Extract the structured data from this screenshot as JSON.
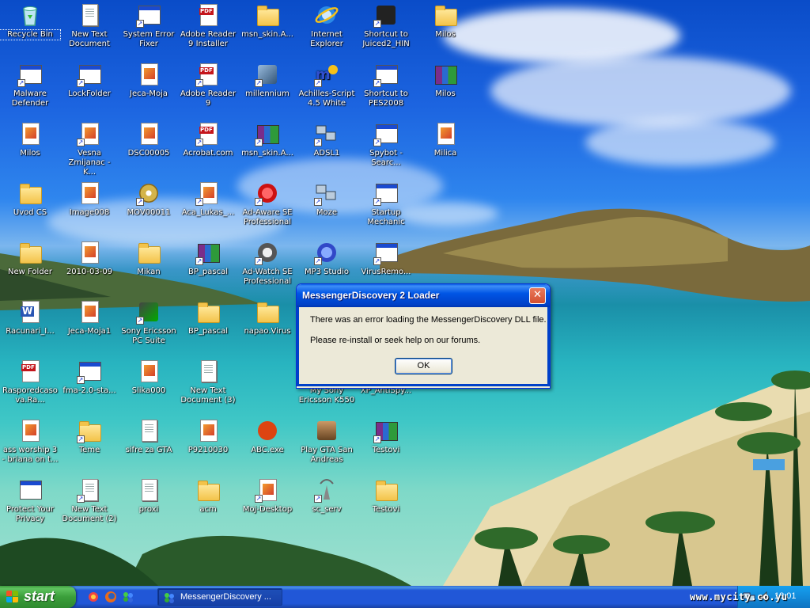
{
  "desktop": {
    "icons": [
      {
        "label": "Recycle Bin"
      },
      {
        "label": "New Text Document"
      },
      {
        "label": "System Error Fixer"
      },
      {
        "label": "Adobe Reader 9 Installer"
      },
      {
        "label": "msn_skin.A..."
      },
      {
        "label": "Internet Explorer"
      },
      {
        "label": "Shortcut to Juiced2_HIN"
      },
      {
        "label": "Milos"
      },
      {
        "label": "Malware Defender"
      },
      {
        "label": "LockFolder"
      },
      {
        "label": "Jeca-Moja"
      },
      {
        "label": "Adobe Reader 9"
      },
      {
        "label": "millennium"
      },
      {
        "label": "Achilles-Script 4.5 White"
      },
      {
        "label": "Shortcut to PES2008"
      },
      {
        "label": "Milos"
      },
      {
        "label": "Milos"
      },
      {
        "label": "Vesna Zmijanac - K..."
      },
      {
        "label": "DSC00005"
      },
      {
        "label": "Acrobat.com"
      },
      {
        "label": "msn_skin.A..."
      },
      {
        "label": "ADSL1"
      },
      {
        "label": "Spybot - Searc..."
      },
      {
        "label": "Milica"
      },
      {
        "label": "Uvod CS"
      },
      {
        "label": "Image008"
      },
      {
        "label": "MOV00011"
      },
      {
        "label": "Aca_Lukas_..."
      },
      {
        "label": "Ad-Aware SE Professional"
      },
      {
        "label": "Moze"
      },
      {
        "label": "Startup Mechanic"
      },
      {
        "label": "New Folder"
      },
      {
        "label": "2010-03-09"
      },
      {
        "label": "Mikan"
      },
      {
        "label": "BP_pascal"
      },
      {
        "label": "Ad-Watch SE Professional"
      },
      {
        "label": "MP3 Studio"
      },
      {
        "label": "VirusRemo..."
      },
      {
        "label": "Racunari_I..."
      },
      {
        "label": "Jeca-Moja1"
      },
      {
        "label": "Sony Ericsson PC Suite"
      },
      {
        "label": "BP_pascal"
      },
      {
        "label": "napao.Virus"
      },
      {
        "label": "Rasporedcasova.Ra..."
      },
      {
        "label": "fma-2.0-sta..."
      },
      {
        "label": "Slika000"
      },
      {
        "label": "New Text Document (3)"
      },
      {
        "label": "My Sony Ericsson K550"
      },
      {
        "label": "XP_AntiSpy..."
      },
      {
        "label": "ass worship 3 - briana on t..."
      },
      {
        "label": "Teme"
      },
      {
        "label": "sifre za GTA"
      },
      {
        "label": "P9210030"
      },
      {
        "label": "ABC.exe"
      },
      {
        "label": "Play GTA San Andreas"
      },
      {
        "label": "Testovi"
      },
      {
        "label": "Protect Your Privacy"
      },
      {
        "label": "New Text Document (2)"
      },
      {
        "label": "proxi"
      },
      {
        "label": "acm"
      },
      {
        "label": "Moj-Desktop"
      },
      {
        "label": "sc_serv"
      },
      {
        "label": "Testovi"
      }
    ]
  },
  "dialog": {
    "title": "MessengerDiscovery 2 Loader",
    "close_symbol": "✕",
    "line1": "There was an error loading the MessengerDiscovery DLL file.",
    "line2": "Please re-install or seek help on our forums.",
    "ok_label": "OK"
  },
  "taskbar": {
    "start_label": "start",
    "task_label": "MessengerDiscovery ...",
    "clock": "18:01",
    "watermark": "www.mycity.co.yu"
  },
  "colors": {
    "accent": "#0041c8",
    "start_green": "#3a9e3a",
    "taskbar_blue": "#2157d7"
  }
}
